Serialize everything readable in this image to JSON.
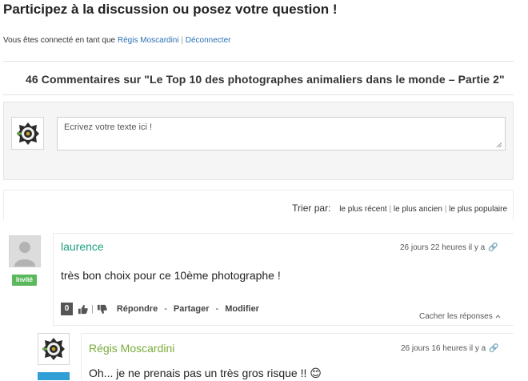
{
  "heading": "Participez à la discussion ou posez votre question !",
  "login": {
    "prefix": "Vous êtes connecté en tant que",
    "user": "Régis Moscardini",
    "separator": "|",
    "logout": "Déconnecter"
  },
  "comments_title": "46 Commentaires sur \"Le Top 10 des photographes animaliers dans le monde – Partie 2\"",
  "form": {
    "placeholder": "Ecrivez votre texte ici !"
  },
  "sort": {
    "label": "Trier par:",
    "options": [
      "le plus récent",
      "le plus ancien",
      "le plus populaire"
    ],
    "separator": "|"
  },
  "comments": [
    {
      "author": "laurence",
      "badge": "Invité",
      "date": "26 jours 22 heures il y a",
      "text": "très bon choix pour ce 10ème photographe !",
      "votes": "0",
      "vote_separator": "|",
      "actions": {
        "reply": "Répondre",
        "dash1": "-",
        "share": "Partager",
        "dash2": "-",
        "edit": "Modifier"
      },
      "hide_replies": "Cacher les réponses"
    },
    {
      "author": "Régis Moscardini",
      "date": "26 jours 16 heures il y a",
      "text": "Oh... je ne prenais pas un très gros risque !! 😊"
    }
  ],
  "colors": {
    "guest_badge": "#5cb85c",
    "member_badge": "#2f9fd6",
    "guest_name": "#1e9e7e",
    "member_name": "#7aab3a",
    "link": "#2b6fb5"
  },
  "icons": [
    "camera-logo",
    "thumb-up-icon",
    "thumb-down-icon",
    "link-icon",
    "chevron-up-icon",
    "default-user-icon"
  ]
}
